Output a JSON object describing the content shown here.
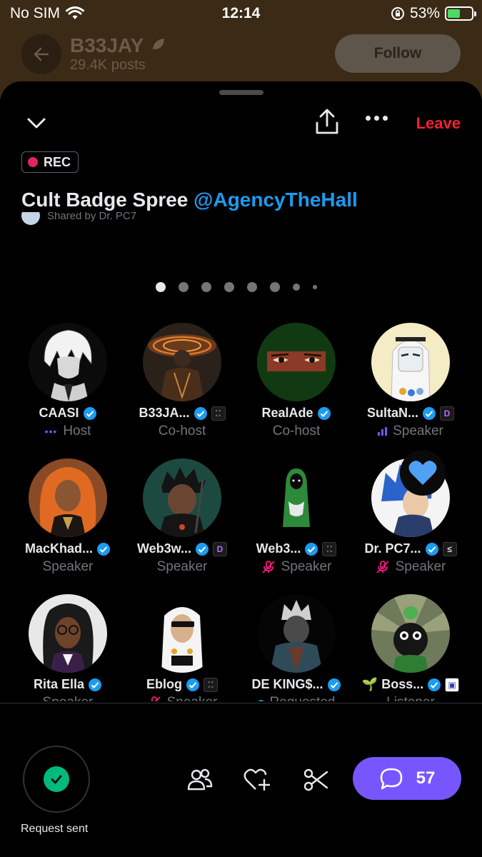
{
  "status_bar": {
    "carrier": "No SIM",
    "time": "12:14",
    "battery": "53%",
    "battery_fraction": 0.53
  },
  "profile": {
    "name": "B33JAY",
    "posts": "29.4K posts",
    "follow_label": "Follow"
  },
  "space": {
    "leave_label": "Leave",
    "rec_label": "REC",
    "title": "Cult Badge Spree ",
    "title_mention": "@AgencyTheHall",
    "shared_by": "Shared by Dr. PC7",
    "page_count": 8,
    "active_page": 0
  },
  "participants": [
    {
      "name": "CAASI",
      "role": "Host",
      "indicator": "dots",
      "verified": true,
      "affiliate": ""
    },
    {
      "name": "B33JA...",
      "role": "Co-host",
      "indicator": "",
      "verified": true,
      "affiliate": "grid"
    },
    {
      "name": "RealAde",
      "role": "Co-host",
      "indicator": "",
      "verified": true,
      "affiliate": ""
    },
    {
      "name": "SultaN...",
      "role": "Speaker",
      "indicator": "bars",
      "verified": true,
      "affiliate": "D"
    },
    {
      "name": "MacKhad...",
      "role": "Speaker",
      "indicator": "",
      "verified": true,
      "affiliate": ""
    },
    {
      "name": "Web3w...",
      "role": "Speaker",
      "indicator": "",
      "verified": true,
      "affiliate": "D"
    },
    {
      "name": "Web3...",
      "role": "Speaker",
      "indicator": "muted",
      "verified": true,
      "affiliate": "grid"
    },
    {
      "name": "Dr. PC7...",
      "role": "Speaker",
      "indicator": "muted",
      "verified": true,
      "affiliate": "<"
    },
    {
      "name": "Rita Ella",
      "role": "Speaker",
      "indicator": "",
      "verified": true,
      "affiliate": ""
    },
    {
      "name": "Eblog",
      "role": "Speaker",
      "indicator": "muted",
      "verified": true,
      "affiliate": "grid"
    },
    {
      "name": "DE KING$...",
      "role": "Requested",
      "indicator": "requested",
      "verified": true,
      "affiliate": ""
    },
    {
      "name": "🌱 Boss...",
      "role": "Listener",
      "indicator": "",
      "verified": true,
      "affiliate": "sq"
    }
  ],
  "bottom_bar": {
    "request_label": "Request sent",
    "chat_count": "57"
  },
  "colors": {
    "accent": "#7856ff",
    "verified": "#1d9bf0",
    "leave": "#f4212e",
    "success": "#00ba7c"
  },
  "icons": [
    "chevron-down-icon",
    "share-icon",
    "more-icon",
    "people-icon",
    "heart-plus-icon",
    "scissors-icon",
    "chat-icon",
    "checkmark-icon",
    "heart-icon"
  ]
}
